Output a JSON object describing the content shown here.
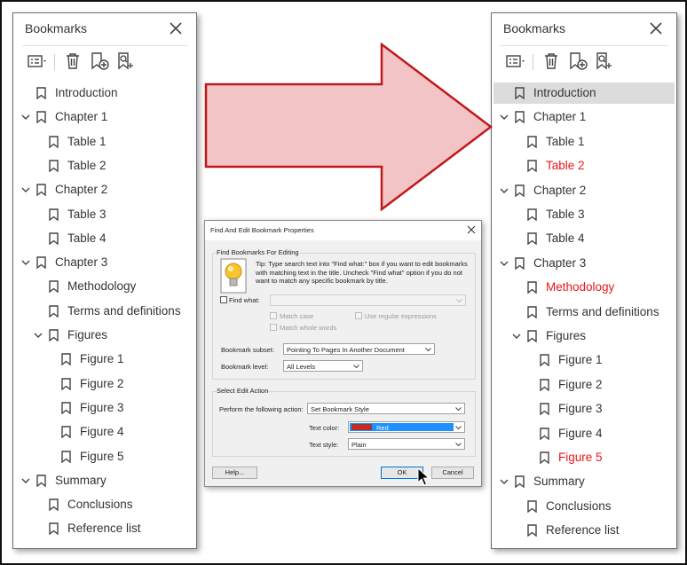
{
  "left_panel": {
    "title": "Bookmarks",
    "items": [
      {
        "label": "Introduction",
        "level": 0,
        "expander": false,
        "selected": false,
        "red": false
      },
      {
        "label": "Chapter 1",
        "level": 0,
        "expander": true,
        "selected": false,
        "red": false
      },
      {
        "label": "Table 1",
        "level": 1,
        "expander": false,
        "selected": false,
        "red": false
      },
      {
        "label": "Table 2",
        "level": 1,
        "expander": false,
        "selected": false,
        "red": false
      },
      {
        "label": "Chapter 2",
        "level": 0,
        "expander": true,
        "selected": false,
        "red": false
      },
      {
        "label": "Table 3",
        "level": 1,
        "expander": false,
        "selected": false,
        "red": false
      },
      {
        "label": "Table 4",
        "level": 1,
        "expander": false,
        "selected": false,
        "red": false
      },
      {
        "label": "Chapter 3",
        "level": 0,
        "expander": true,
        "selected": false,
        "red": false
      },
      {
        "label": "Methodology",
        "level": 1,
        "expander": false,
        "selected": false,
        "red": false
      },
      {
        "label": "Terms and definitions",
        "level": 1,
        "expander": false,
        "selected": false,
        "red": false
      },
      {
        "label": "Figures",
        "level": 1,
        "expander": true,
        "selected": false,
        "red": false
      },
      {
        "label": "Figure 1",
        "level": 2,
        "expander": false,
        "selected": false,
        "red": false
      },
      {
        "label": "Figure 2",
        "level": 2,
        "expander": false,
        "selected": false,
        "red": false
      },
      {
        "label": "Figure 3",
        "level": 2,
        "expander": false,
        "selected": false,
        "red": false
      },
      {
        "label": "Figure 4",
        "level": 2,
        "expander": false,
        "selected": false,
        "red": false
      },
      {
        "label": "Figure 5",
        "level": 2,
        "expander": false,
        "selected": false,
        "red": false
      },
      {
        "label": "Summary",
        "level": 0,
        "expander": true,
        "selected": false,
        "red": false
      },
      {
        "label": "Conclusions",
        "level": 1,
        "expander": false,
        "selected": false,
        "red": false
      },
      {
        "label": "Reference list",
        "level": 1,
        "expander": false,
        "selected": false,
        "red": false
      }
    ]
  },
  "right_panel": {
    "title": "Bookmarks",
    "items": [
      {
        "label": "Introduction",
        "level": 0,
        "expander": false,
        "selected": true,
        "red": false
      },
      {
        "label": "Chapter 1",
        "level": 0,
        "expander": true,
        "selected": false,
        "red": false
      },
      {
        "label": "Table 1",
        "level": 1,
        "expander": false,
        "selected": false,
        "red": false
      },
      {
        "label": "Table 2",
        "level": 1,
        "expander": false,
        "selected": false,
        "red": true
      },
      {
        "label": "Chapter 2",
        "level": 0,
        "expander": true,
        "selected": false,
        "red": false
      },
      {
        "label": "Table 3",
        "level": 1,
        "expander": false,
        "selected": false,
        "red": false
      },
      {
        "label": "Table 4",
        "level": 1,
        "expander": false,
        "selected": false,
        "red": false
      },
      {
        "label": "Chapter 3",
        "level": 0,
        "expander": true,
        "selected": false,
        "red": false
      },
      {
        "label": "Methodology",
        "level": 1,
        "expander": false,
        "selected": false,
        "red": true
      },
      {
        "label": "Terms and definitions",
        "level": 1,
        "expander": false,
        "selected": false,
        "red": false
      },
      {
        "label": "Figures",
        "level": 1,
        "expander": true,
        "selected": false,
        "red": false
      },
      {
        "label": "Figure 1",
        "level": 2,
        "expander": false,
        "selected": false,
        "red": false
      },
      {
        "label": "Figure 2",
        "level": 2,
        "expander": false,
        "selected": false,
        "red": false
      },
      {
        "label": "Figure 3",
        "level": 2,
        "expander": false,
        "selected": false,
        "red": false
      },
      {
        "label": "Figure 4",
        "level": 2,
        "expander": false,
        "selected": false,
        "red": false
      },
      {
        "label": "Figure 5",
        "level": 2,
        "expander": false,
        "selected": false,
        "red": true
      },
      {
        "label": "Summary",
        "level": 0,
        "expander": true,
        "selected": false,
        "red": false
      },
      {
        "label": "Conclusions",
        "level": 1,
        "expander": false,
        "selected": false,
        "red": false
      },
      {
        "label": "Reference list",
        "level": 1,
        "expander": false,
        "selected": false,
        "red": false
      }
    ]
  },
  "toolbar_icons": [
    "options-menu-icon",
    "delete-icon",
    "new-bookmark-icon",
    "find-bookmark-icon"
  ],
  "arrow": {
    "fill": "#f2c4c6",
    "stroke": "#c0191c"
  },
  "dialog": {
    "title": "Find And Edit Bookmark Properties",
    "find_group_title": "Find Bookmarks For Editing",
    "tip": "Tip: Type search text into \"Find what:\" box if you want to edit bookmarks with matching text in the title. Uncheck \"Find what\" option if you do not want to match any specific bookmark by title.",
    "find_what_label": "Find what:",
    "match_case_label": "Match case",
    "regex_label": "Use regular expressions",
    "whole_words_label": "Match whole words",
    "subset_label": "Bookmark subset:",
    "subset_value": "Pointing To Pages In Another Document",
    "level_label": "Bookmark level:",
    "level_value": "All Levels",
    "edit_group_title": "Select Edit Action",
    "action_label": "Perform the following action:",
    "action_value": "Set Bookmark Style",
    "text_color_label": "Text color:",
    "text_color_value": "Red",
    "text_color_highlight": "#1e90ff",
    "text_color_swatch": "#e41b17",
    "text_style_label": "Text style:",
    "text_style_value": "Plain",
    "help_button": "Help...",
    "ok_button": "OK",
    "cancel_button": "Cancel"
  },
  "colors": {
    "red_text": "#e8161b",
    "selected_row": "#dcdcdc"
  }
}
